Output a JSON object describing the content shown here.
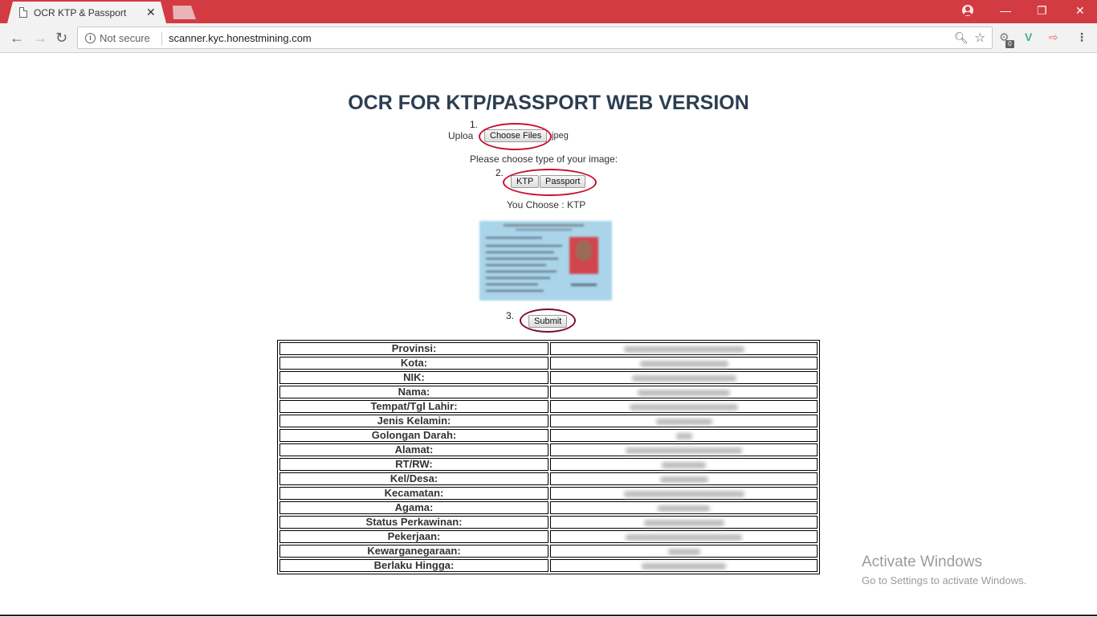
{
  "browser": {
    "tab_title": "OCR KTP & Passport",
    "tab_close": "✕",
    "security_label": "Not secure",
    "url": "scanner.kyc.honestmining.com",
    "extension_badge": "0",
    "accent_color": "#d33b43"
  },
  "page": {
    "title": "OCR FOR KTP/PASSPORT WEB VERSION",
    "step1": "1.",
    "upload_label": "Uploa",
    "choose_files_label": "Choose Files",
    "file_suffix": ".jpeg",
    "type_prompt": "Please choose type of your image:",
    "step2": "2.",
    "ktp_label": "KTP",
    "passport_label": "Passport",
    "you_choose": "You Choose : KTP",
    "step3": "3.",
    "submit_label": "Submit"
  },
  "results": {
    "rows": [
      {
        "label": "Provinsi:",
        "value_blurred": true
      },
      {
        "label": "Kota:",
        "value_blurred": true
      },
      {
        "label": "NIK:",
        "value_blurred": true
      },
      {
        "label": "Nama:",
        "value_blurred": true
      },
      {
        "label": "Tempat/Tgl Lahir:",
        "value_blurred": true
      },
      {
        "label": "Jenis Kelamin:",
        "value_blurred": true
      },
      {
        "label": "Golongan Darah:",
        "value_blurred": true
      },
      {
        "label": "Alamat:",
        "value_blurred": true
      },
      {
        "label": "RT/RW:",
        "value_blurred": true
      },
      {
        "label": "Kel/Desa:",
        "value_blurred": true
      },
      {
        "label": "Kecamatan:",
        "value_blurred": true
      },
      {
        "label": "Agama:",
        "value_blurred": true
      },
      {
        "label": "Status Perkawinan:",
        "value_blurred": true
      },
      {
        "label": "Pekerjaan:",
        "value_blurred": true
      },
      {
        "label": "Kewarganegaraan:",
        "value_blurred": true
      },
      {
        "label": "Berlaku Hingga:",
        "value_blurred": true
      }
    ]
  },
  "overlay": {
    "activate_title": "Activate Windows",
    "activate_sub": "Go to Settings to activate Windows."
  }
}
